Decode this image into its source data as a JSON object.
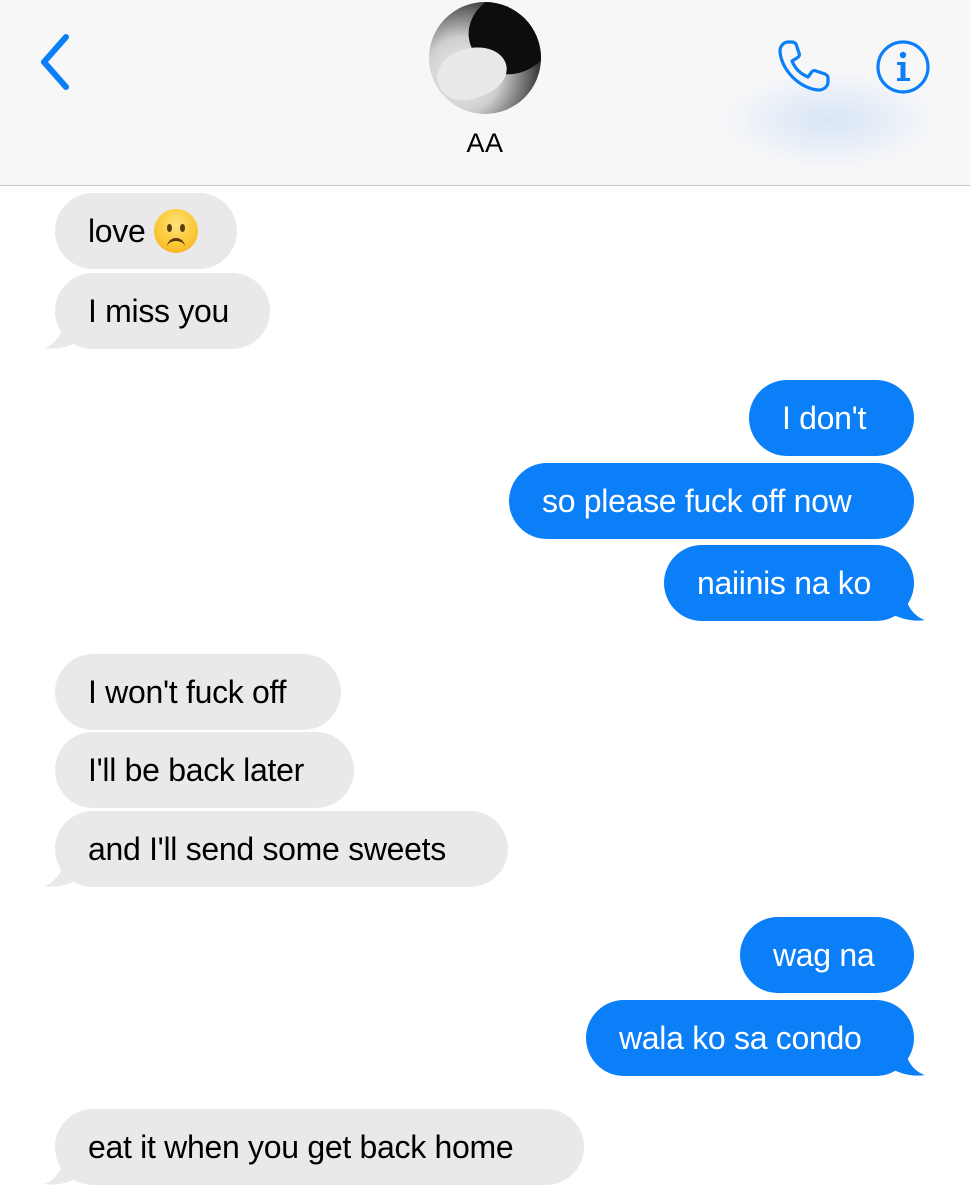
{
  "header": {
    "contact_name": "AA",
    "back_icon": "chevron-left-icon",
    "call_icon": "phone-icon",
    "info_icon": "info-icon",
    "accent_color": "#0b7ff8"
  },
  "messages": [
    {
      "sender": "them",
      "text": "love",
      "emoji": "frowning-face"
    },
    {
      "sender": "them",
      "text": "I miss you"
    },
    {
      "sender": "me",
      "text": "I don't"
    },
    {
      "sender": "me",
      "text": "so please fuck off now"
    },
    {
      "sender": "me",
      "text": "naiinis na ko"
    },
    {
      "sender": "them",
      "text": "I won't fuck off"
    },
    {
      "sender": "them",
      "text": "I'll be back later"
    },
    {
      "sender": "them",
      "text": "and I'll send some sweets"
    },
    {
      "sender": "me",
      "text": "wag na"
    },
    {
      "sender": "me",
      "text": "wala ko sa condo"
    },
    {
      "sender": "them",
      "text": "eat it when you get back home"
    }
  ],
  "colors": {
    "incoming_bubble": "#e9e9eb",
    "outgoing_bubble": "#0b7ff8",
    "header_background": "#f7f7f8"
  }
}
